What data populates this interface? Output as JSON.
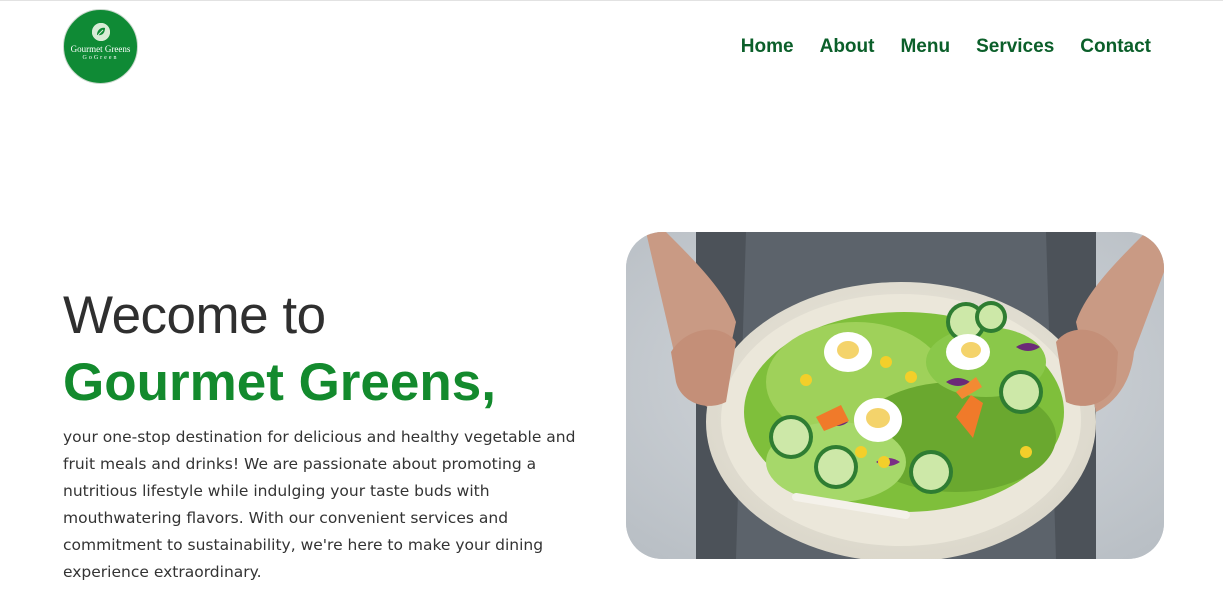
{
  "header": {
    "logo": {
      "name": "Gourmet Greens",
      "tagline": "GoGreen",
      "icon": "leaf-icon"
    },
    "nav": [
      {
        "label": "Home"
      },
      {
        "label": "About"
      },
      {
        "label": "Menu"
      },
      {
        "label": "Services"
      },
      {
        "label": "Contact"
      }
    ]
  },
  "hero": {
    "welcome": "Wecome to",
    "brand": "Gourmet Greens,",
    "description": "your one-stop destination for delicious and healthy vegetable and fruit meals and drinks! We are passionate about promoting a nutritious lifestyle while indulging your taste buds with mouthwatering flavors. With our convenient services and commitment to sustainability, we're here to make your dining experience extraordinary.",
    "image": "salad-bowl-photo"
  },
  "colors": {
    "brand_green": "#138a2d",
    "nav_green": "#0b5f2a",
    "logo_bg": "#0f8a35",
    "text_dark": "#333333"
  }
}
